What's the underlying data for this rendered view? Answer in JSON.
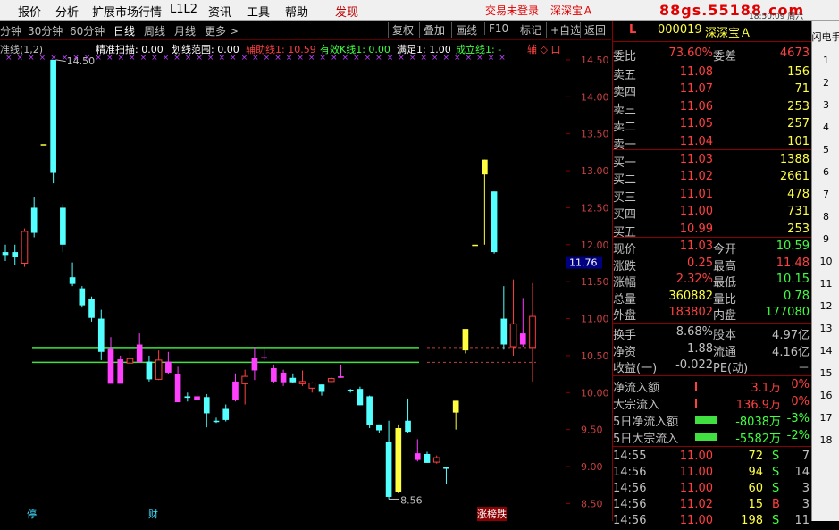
{
  "menubar": {
    "items": [
      "报价",
      "分析",
      "扩展市场行情",
      "L1L2",
      "资讯",
      "工具",
      "帮助"
    ],
    "discover": "发现",
    "login_status": "交易未登录",
    "stock_short": "深深宝Ａ",
    "brand": "88gs.55188.com"
  },
  "toolbar": {
    "periods": [
      "分钟",
      "30分钟",
      "60分钟",
      "日线",
      "周线",
      "月线",
      "更多 >"
    ],
    "buttons": [
      "复权",
      "叠加",
      "画线",
      "F10",
      "标记",
      "+自选",
      "返回"
    ]
  },
  "indicator": {
    "name": "准线(1,2)",
    "items": [
      {
        "text": "精准扫描: 0.00",
        "color": "#ffffff"
      },
      {
        "text": "划线范围: 0.00",
        "color": "#ffffff"
      },
      {
        "text": "辅助线1: 10.59",
        "color": "#ff4040"
      },
      {
        "text": "有效K线1: 0.00",
        "color": "#40ff40"
      },
      {
        "text": "满足1: 1.00",
        "color": "#ffffff"
      },
      {
        "text": "成立线1: -",
        "color": "#40ff40"
      },
      {
        "text": "辅 ◇ 口",
        "color": "#ff4040"
      }
    ]
  },
  "chart_data": {
    "type": "candlestick",
    "price_axis": {
      "ticks": [
        "14.50",
        "14.00",
        "13.50",
        "13.00",
        "12.50",
        "12.00",
        "11.50",
        "11.00",
        "10.50",
        "10.00",
        "9.50",
        "9.00",
        "8.50"
      ],
      "ylim": [
        8.36,
        14.62
      ]
    },
    "current_price_label": "11.76",
    "high_label": "14.50",
    "low_label": "8.56",
    "support_lines": [
      10.61,
      10.41
    ],
    "candles": [
      {
        "o": 11.86,
        "h": 12.0,
        "l": 11.78,
        "c": 11.9,
        "color": "cyan"
      },
      {
        "o": 11.83,
        "h": 12.0,
        "l": 11.72,
        "c": 11.9,
        "color": "cyan"
      },
      {
        "o": 12.18,
        "h": 12.22,
        "l": 11.7,
        "c": 11.75,
        "color": "red"
      },
      {
        "o": 12.16,
        "h": 12.65,
        "l": 12.1,
        "c": 12.5,
        "color": "cyan"
      },
      {
        "o": 13.36,
        "h": 13.36,
        "l": 13.36,
        "c": 13.36,
        "color": "yellow"
      },
      {
        "o": 14.5,
        "h": 14.5,
        "l": 12.83,
        "c": 12.97,
        "color": "cyan"
      },
      {
        "o": 12.5,
        "h": 12.55,
        "l": 11.9,
        "c": 12.0,
        "color": "cyan"
      },
      {
        "o": 11.56,
        "h": 11.76,
        "l": 11.44,
        "c": 11.47,
        "color": "cyan"
      },
      {
        "o": 11.41,
        "h": 11.44,
        "l": 11.15,
        "c": 11.18,
        "color": "cyan"
      },
      {
        "o": 11.27,
        "h": 11.3,
        "l": 10.96,
        "c": 11.01,
        "color": "cyan"
      },
      {
        "o": 11.0,
        "h": 11.12,
        "l": 10.44,
        "c": 10.55,
        "color": "cyan"
      },
      {
        "o": 10.6,
        "h": 10.75,
        "l": 10.13,
        "c": 10.12,
        "color": "magenta"
      },
      {
        "o": 10.45,
        "h": 10.5,
        "l": 10.13,
        "c": 10.12,
        "color": "magenta"
      },
      {
        "o": 10.46,
        "h": 10.6,
        "l": 10.4,
        "c": 10.4,
        "color": "hollow"
      },
      {
        "o": 10.65,
        "h": 10.8,
        "l": 10.41,
        "c": 10.41,
        "color": "magenta"
      },
      {
        "o": 10.42,
        "h": 10.5,
        "l": 10.15,
        "c": 10.18,
        "color": "cyan"
      },
      {
        "o": 10.18,
        "h": 10.57,
        "l": 10.17,
        "c": 10.44,
        "color": "hollow"
      },
      {
        "o": 10.42,
        "h": 10.55,
        "l": 10.25,
        "c": 10.27,
        "color": "magenta"
      },
      {
        "o": 10.25,
        "h": 10.35,
        "l": 9.89,
        "c": 9.87,
        "color": "magenta"
      },
      {
        "o": 9.95,
        "h": 10.0,
        "l": 9.88,
        "c": 9.93,
        "color": "cyan"
      },
      {
        "o": 9.95,
        "h": 10.0,
        "l": 9.9,
        "c": 9.9,
        "color": "magenta"
      },
      {
        "o": 9.94,
        "h": 9.98,
        "l": 9.53,
        "c": 9.72,
        "color": "cyan"
      },
      {
        "o": 9.62,
        "h": 9.66,
        "l": 9.59,
        "c": 9.62,
        "color": "cyan"
      },
      {
        "o": 9.78,
        "h": 9.84,
        "l": 9.61,
        "c": 9.63,
        "color": "cyan"
      },
      {
        "o": 10.15,
        "h": 10.26,
        "l": 9.88,
        "c": 9.9,
        "color": "magenta"
      },
      {
        "o": 10.22,
        "h": 10.31,
        "l": 9.84,
        "c": 10.12,
        "color": "hollow"
      },
      {
        "o": 10.47,
        "h": 10.62,
        "l": 10.17,
        "c": 10.3,
        "color": "magenta"
      },
      {
        "o": 10.48,
        "h": 10.6,
        "l": 10.44,
        "c": 10.47,
        "color": "magenta"
      },
      {
        "o": 10.33,
        "h": 10.38,
        "l": 10.13,
        "c": 10.15,
        "color": "magenta"
      },
      {
        "o": 10.27,
        "h": 10.31,
        "l": 10.09,
        "c": 10.14,
        "color": "magenta"
      },
      {
        "o": 10.2,
        "h": 10.26,
        "l": 10.13,
        "c": 10.14,
        "color": "cyan"
      },
      {
        "o": 10.15,
        "h": 10.3,
        "l": 10.09,
        "c": 10.12,
        "color": "hollow"
      },
      {
        "o": 10.06,
        "h": 10.14,
        "l": 10.0,
        "c": 10.13,
        "color": "hollow"
      },
      {
        "o": 10.11,
        "h": 10.11,
        "l": 9.96,
        "c": 10.01,
        "color": "cyan"
      },
      {
        "o": 10.19,
        "h": 10.21,
        "l": 10.14,
        "c": 10.15,
        "color": "hollow"
      },
      {
        "o": 10.22,
        "h": 10.38,
        "l": 10.2,
        "c": 10.2,
        "color": "magenta"
      },
      {
        "o": 10.02,
        "h": 10.05,
        "l": 10.0,
        "c": 10.04,
        "color": "cyan"
      },
      {
        "o": 10.05,
        "h": 10.08,
        "l": 9.83,
        "c": 9.83,
        "color": "cyan"
      },
      {
        "o": 9.95,
        "h": 9.96,
        "l": 9.52,
        "c": 9.56,
        "color": "cyan"
      },
      {
        "o": 9.57,
        "h": 9.57,
        "l": 9.46,
        "c": 9.49,
        "color": "cyan"
      },
      {
        "o": 9.33,
        "h": 9.62,
        "l": 8.56,
        "c": 8.59,
        "color": "cyan"
      },
      {
        "o": 8.66,
        "h": 9.57,
        "l": 8.64,
        "c": 9.52,
        "color": "yellow"
      },
      {
        "o": 9.62,
        "h": 9.92,
        "l": 9.46,
        "c": 9.47,
        "color": "cyan"
      },
      {
        "o": 9.18,
        "h": 9.37,
        "l": 9.07,
        "c": 9.09,
        "color": "magenta"
      },
      {
        "o": 9.17,
        "h": 9.2,
        "l": 9.05,
        "c": 9.05,
        "color": "cyan"
      },
      {
        "o": 9.12,
        "h": 9.15,
        "l": 9.04,
        "c": 9.06,
        "color": "hollow"
      },
      {
        "o": 9.0,
        "h": 9.0,
        "l": 8.76,
        "c": 8.97,
        "color": "cyan"
      },
      {
        "o": 9.89,
        "h": 9.89,
        "l": 9.5,
        "c": 9.73,
        "color": "yellow"
      },
      {
        "o": 10.57,
        "h": 10.57,
        "l": 10.53,
        "c": 10.86,
        "color": "yellow"
      },
      {
        "o": 12.0,
        "h": 12.0,
        "l": 12.0,
        "c": 12.0,
        "color": "yellow"
      },
      {
        "o": 13.15,
        "h": 13.15,
        "l": 12.0,
        "c": 12.95,
        "color": "yellow"
      },
      {
        "o": 12.72,
        "h": 12.72,
        "l": 11.88,
        "c": 11.9,
        "color": "cyan"
      },
      {
        "o": 11.0,
        "h": 11.44,
        "l": 10.58,
        "c": 10.65,
        "color": "cyan"
      },
      {
        "o": 10.93,
        "h": 11.53,
        "l": 10.5,
        "c": 10.62,
        "color": "hollow"
      },
      {
        "o": 10.8,
        "h": 11.28,
        "l": 10.62,
        "c": 10.65,
        "color": "magenta"
      },
      {
        "o": 11.03,
        "h": 11.48,
        "l": 10.15,
        "c": 10.61,
        "color": "red"
      }
    ]
  },
  "bottom_markers": [
    {
      "text": "停",
      "color": "#40e0ff"
    },
    {
      "text": "财",
      "color": "#40e0ff"
    },
    {
      "text": "涨榜跌",
      "color": "#ffffff"
    }
  ],
  "quote_panel": {
    "flag": "L",
    "code": "000019",
    "name": "深深宝Ａ",
    "weibi_label": "委比",
    "weibi": "73.60%",
    "weicha_label": "委差",
    "weicha": "4673",
    "asks": [
      {
        "label": "卖五",
        "price": "11.08",
        "vol": "156"
      },
      {
        "label": "卖四",
        "price": "11.07",
        "vol": "71"
      },
      {
        "label": "卖三",
        "price": "11.06",
        "vol": "253"
      },
      {
        "label": "卖二",
        "price": "11.05",
        "vol": "257"
      },
      {
        "label": "卖一",
        "price": "11.04",
        "vol": "101"
      }
    ],
    "bids": [
      {
        "label": "买一",
        "price": "11.03",
        "vol": "1388"
      },
      {
        "label": "买二",
        "price": "11.02",
        "vol": "2661"
      },
      {
        "label": "买三",
        "price": "11.01",
        "vol": "478"
      },
      {
        "label": "买四",
        "price": "11.00",
        "vol": "731"
      },
      {
        "label": "买五",
        "price": "10.99",
        "vol": "253"
      }
    ],
    "stats": [
      {
        "l1": "现价",
        "v1": "11.03",
        "c1": "#ff4040",
        "l2": "今开",
        "v2": "10.59",
        "c2": "#40ff40"
      },
      {
        "l1": "涨跌",
        "v1": "0.25",
        "c1": "#ff4040",
        "l2": "最高",
        "v2": "11.48",
        "c2": "#ff4040"
      },
      {
        "l1": "涨幅",
        "v1": "2.32%",
        "c1": "#ff4040",
        "l2": "最低",
        "v2": "10.15",
        "c2": "#40ff40"
      },
      {
        "l1": "总量",
        "v1": "360882",
        "c1": "#ffff40",
        "l2": "量比",
        "v2": "0.78",
        "c2": "#40ff40"
      },
      {
        "l1": "外盘",
        "v1": "183802",
        "c1": "#ff4040",
        "l2": "内盘",
        "v2": "177080",
        "c2": "#40ff40"
      }
    ],
    "fund": [
      {
        "l1": "换手",
        "v1": "8.68%",
        "l2": "股本",
        "v2": "4.97亿"
      },
      {
        "l1": "净资",
        "v1": "1.88",
        "l2": "流通",
        "v2": "4.16亿"
      },
      {
        "l1": "收益(一)",
        "v1": "-0.022",
        "l2": "PE(动)",
        "v2": "－"
      }
    ],
    "flows": [
      {
        "label": "净流入额",
        "value": "3.1万",
        "pct": "0%",
        "color": "#ff4040",
        "bar": "red"
      },
      {
        "label": "大宗流入",
        "value": "136.9万",
        "pct": "0%",
        "color": "#ff4040",
        "bar": "red"
      },
      {
        "label": "5日净流入额",
        "value": "-8038万",
        "pct": "-3%",
        "color": "#40ff40",
        "bar": "green"
      },
      {
        "label": "5日大宗流入",
        "value": "-5582万",
        "pct": "-2%",
        "color": "#40ff40",
        "bar": "green"
      }
    ],
    "ticks": [
      {
        "time": "14:55",
        "price": "11.00",
        "vol": "72",
        "side": "S",
        "n": "7"
      },
      {
        "time": "14:56",
        "price": "11.00",
        "vol": "94",
        "side": "S",
        "n": "14"
      },
      {
        "time": "14:56",
        "price": "11.00",
        "vol": "60",
        "side": "S",
        "n": "3"
      },
      {
        "time": "14:56",
        "price": "11.02",
        "vol": "15",
        "side": "B",
        "n": "3"
      },
      {
        "time": "14:56",
        "price": "11.00",
        "vol": "198",
        "side": "S",
        "n": "11"
      }
    ]
  },
  "right_tabs": {
    "top": "闪电手",
    "numbers": [
      "1",
      "2",
      "3",
      "4",
      "5",
      "6",
      "7",
      "8",
      "9",
      "10",
      "11",
      "12",
      "13",
      "14",
      "15",
      "16",
      "17",
      "18"
    ]
  },
  "window_clock": "18:50:09 周六",
  "colors": {
    "up": "#ff4040",
    "down": "#54ffff",
    "flat": "#ffff40",
    "magenta": "#ff40ff",
    "green_line": "#40ff40",
    "border": "#8b0000"
  }
}
